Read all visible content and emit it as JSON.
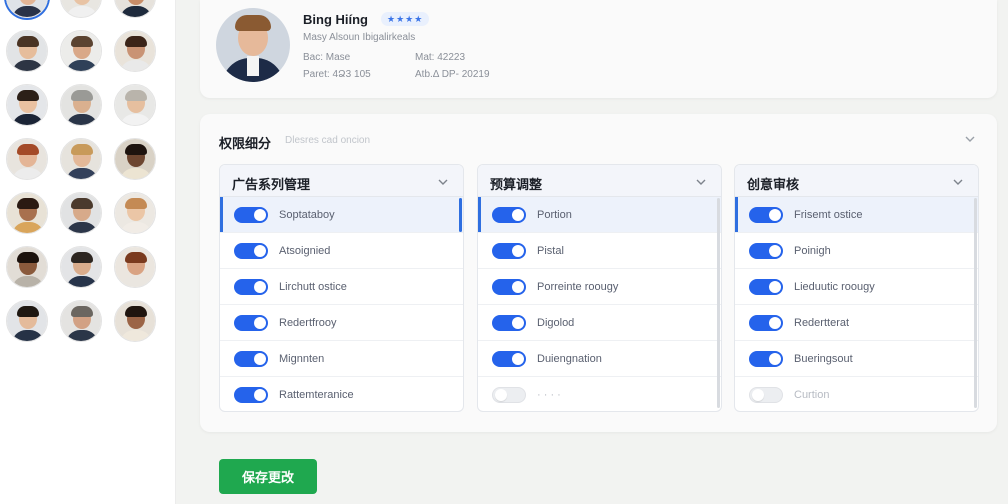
{
  "sidebar": {
    "avatars": [
      {
        "skin": "#e2b596",
        "hair": "#3a2a20",
        "shirt": "#2a3348",
        "bg": "#dfe3e8"
      },
      {
        "skin": "#e8c3a4",
        "hair": "#7a5838",
        "shirt": "#f0f0f0",
        "bg": "#e8e6e1"
      },
      {
        "skin": "#c88d68",
        "hair": "#2a1b14",
        "shirt": "#1e2a3c",
        "bg": "#e6e2dc"
      },
      {
        "skin": "#e6bd9c",
        "hair": "#4a3424",
        "shirt": "#2d3544",
        "bg": "#e2e4e6"
      },
      {
        "skin": "#d9a888",
        "hair": "#5b4331",
        "shirt": "#2f4058",
        "bg": "#ececea"
      },
      {
        "skin": "#c99374",
        "hair": "#3b2418",
        "shirt": "#e9e9e9",
        "bg": "#e9e3da"
      },
      {
        "skin": "#e9c1a1",
        "hair": "#2c2018",
        "shirt": "#1b2436",
        "bg": "#e4e6e9"
      },
      {
        "skin": "#dab08f",
        "hair": "#9a9a96",
        "shirt": "#2a3548",
        "bg": "#e3e3e1"
      },
      {
        "skin": "#e6bf9f",
        "hair": "#b9b4ab",
        "shirt": "#f2f2f2",
        "bg": "#e8e8e6"
      },
      {
        "skin": "#e4b596",
        "hair": "#a44a27",
        "shirt": "#ececec",
        "bg": "#e8e4de"
      },
      {
        "skin": "#e3b898",
        "hair": "#c89a5a",
        "shirt": "#33405a",
        "bg": "#e6e3dd"
      },
      {
        "skin": "#6d4630",
        "hair": "#1d130e",
        "shirt": "#ece4d2",
        "bg": "#d9d2c6"
      },
      {
        "skin": "#a8704e",
        "hair": "#2b1a12",
        "shirt": "#d9a55b",
        "bg": "#e8e2d6"
      },
      {
        "skin": "#d7aa8a",
        "hair": "#4b3a2d",
        "shirt": "#2c3649",
        "bg": "#e1e2e3"
      },
      {
        "skin": "#ebc6a6",
        "hair": "#c48a54",
        "shirt": "#f1ece6",
        "bg": "#ece8e2"
      },
      {
        "skin": "#8a5a3c",
        "hair": "#1c120c",
        "shirt": "#b8b2a8",
        "bg": "#e2ddd6"
      },
      {
        "skin": "#d9ac8c",
        "hair": "#2d2621",
        "shirt": "#27344a",
        "bg": "#e3e4e6"
      },
      {
        "skin": "#d9a383",
        "hair": "#7a3a1e",
        "shirt": "#eae6e0",
        "bg": "#ebe6df"
      },
      {
        "skin": "#e4bb9b",
        "hair": "#1f1812",
        "shirt": "#263246",
        "bg": "#e2e4e7"
      },
      {
        "skin": "#d2a184",
        "hair": "#6b6660",
        "shirt": "#2b3648",
        "bg": "#e4e3e1"
      },
      {
        "skin": "#9b6446",
        "hair": "#20150f",
        "shirt": "#efe8dc",
        "bg": "#e7e1d8"
      }
    ]
  },
  "profile": {
    "name": "Bing Hiíng",
    "rating": "★★★★",
    "subtitle": "Masy Alsoun Ibigalirkeals",
    "meta": {
      "bac": "Bac: Mase",
      "mat": "Mat: 42223",
      "paret": "Paret: 4Ձ3 105",
      "code": "Atb.Δ DP- 20219"
    }
  },
  "permissions": {
    "title": "权限细分",
    "hint": "Dlesres cad oncion",
    "columns": [
      {
        "title": "广告系列管理",
        "rows": [
          {
            "label": "Soptataboy",
            "on": true,
            "active": true
          },
          {
            "label": "Atsoignied",
            "on": true,
            "active": false
          },
          {
            "label": "Lirchutt ostice",
            "on": true,
            "active": false
          },
          {
            "label": "Redertfrooy",
            "on": true,
            "active": false
          },
          {
            "label": "Mignnten",
            "on": true,
            "active": false
          },
          {
            "label": "Rattemteranice",
            "on": true,
            "active": false
          }
        ]
      },
      {
        "title": "预算调整",
        "rows": [
          {
            "label": "Portion",
            "on": true,
            "active": true
          },
          {
            "label": "Pistal",
            "on": true,
            "active": false
          },
          {
            "label": "Porreinte roougy",
            "on": true,
            "active": false
          },
          {
            "label": "Digolod",
            "on": true,
            "active": false
          },
          {
            "label": "Duiengnation",
            "on": true,
            "active": false
          },
          {
            "label": "· · · ·",
            "on": false,
            "active": false
          }
        ]
      },
      {
        "title": "创意审核",
        "rows": [
          {
            "label": "Frisemt ostice",
            "on": true,
            "active": true
          },
          {
            "label": "Poinigh",
            "on": true,
            "active": false
          },
          {
            "label": "Lieduutic roougy",
            "on": true,
            "active": false
          },
          {
            "label": "Redertterat",
            "on": true,
            "active": false
          },
          {
            "label": "Bueringsout",
            "on": true,
            "active": false
          },
          {
            "label": "Curtion",
            "on": false,
            "active": false
          }
        ]
      }
    ]
  },
  "actions": {
    "save_label": "保存更改"
  },
  "colors": {
    "accent": "#2563eb",
    "save": "#1fa84f"
  }
}
